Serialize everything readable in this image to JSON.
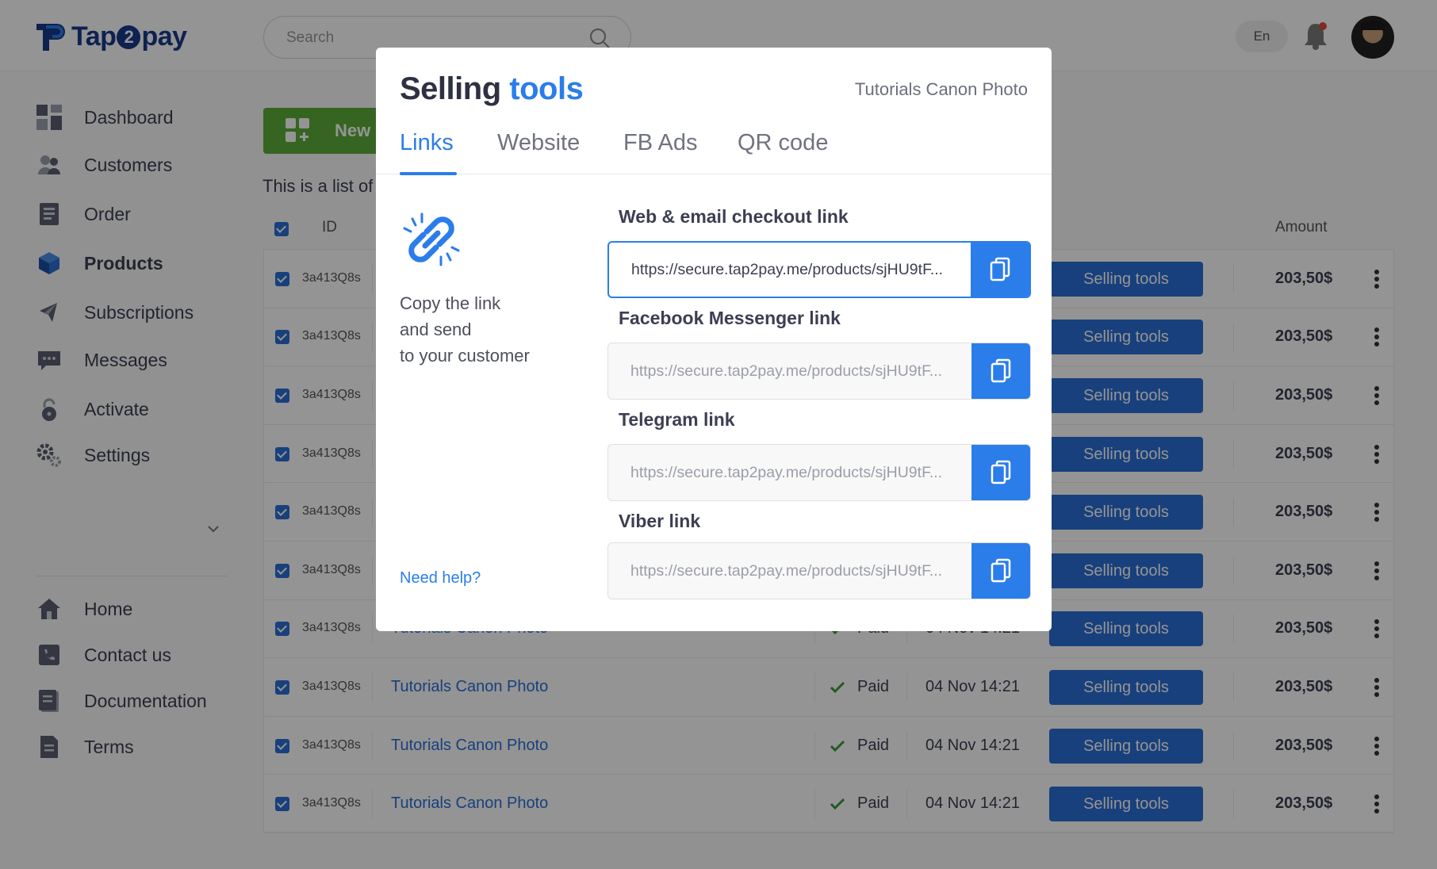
{
  "app": {
    "logo_text_before": "Tap",
    "logo_text_digit": "2",
    "logo_text_after": "pay",
    "brand_color": "#1b3a8c",
    "accent_color": "#2b7de9"
  },
  "header": {
    "search_placeholder": "Search",
    "language": "En"
  },
  "sidebar": {
    "items": [
      {
        "label": "Dashboard",
        "icon": "dashboard-icon"
      },
      {
        "label": "Customers",
        "icon": "customers-icon"
      },
      {
        "label": "Order",
        "icon": "order-icon"
      },
      {
        "label": "Products",
        "icon": "products-icon",
        "active": true
      },
      {
        "label": "Subscriptions",
        "icon": "subscriptions-icon"
      },
      {
        "label": "Messages",
        "icon": "messages-icon"
      },
      {
        "label": "Activate",
        "icon": "lock-icon"
      },
      {
        "label": "Settings",
        "icon": "gear-icon"
      }
    ],
    "footer_items": [
      {
        "label": "Home",
        "icon": "home-icon"
      },
      {
        "label": "Contact us",
        "icon": "phone-icon"
      },
      {
        "label": "Documentation",
        "icon": "documentation-icon"
      },
      {
        "label": "Terms",
        "icon": "document-icon"
      }
    ]
  },
  "main": {
    "new_button_label": "New p",
    "list_caption": "This is a list of",
    "columns": {
      "id": "ID",
      "amount": "Amount"
    },
    "rows": [
      {
        "id": "3a413Q8s",
        "name": "",
        "status": "",
        "date": "",
        "action": "Selling tools",
        "amount": "203,50$"
      },
      {
        "id": "3a413Q8s",
        "name": "",
        "status": "",
        "date": "",
        "action": "Selling tools",
        "amount": "203,50$"
      },
      {
        "id": "3a413Q8s",
        "name": "",
        "status": "",
        "date": "",
        "action": "Selling tools",
        "amount": "203,50$"
      },
      {
        "id": "3a413Q8s",
        "name": "",
        "status": "",
        "date": "",
        "action": "Selling tools",
        "amount": "203,50$"
      },
      {
        "id": "3a413Q8s",
        "name": "",
        "status": "",
        "date": "",
        "action": "Selling tools",
        "amount": "203,50$"
      },
      {
        "id": "3a413Q8s",
        "name": "",
        "status": "",
        "date": "",
        "action": "Selling tools",
        "amount": "203,50$"
      },
      {
        "id": "3a413Q8s",
        "name": "Tutorials Canon Photo",
        "status": "Paid",
        "date": "04 Nov 14:21",
        "action": "Selling tools",
        "amount": "203,50$"
      },
      {
        "id": "3a413Q8s",
        "name": "Tutorials Canon Photo",
        "status": "Paid",
        "date": "04 Nov 14:21",
        "action": "Selling tools",
        "amount": "203,50$"
      },
      {
        "id": "3a413Q8s",
        "name": "Tutorials Canon Photo",
        "status": "Paid",
        "date": "04 Nov 14:21",
        "action": "Selling tools",
        "amount": "203,50$"
      },
      {
        "id": "3a413Q8s",
        "name": "Tutorials Canon Photo",
        "status": "Paid",
        "date": "04 Nov 14:21",
        "action": "Selling tools",
        "amount": "203,50$"
      }
    ]
  },
  "modal": {
    "title_part1": "Selling",
    "title_part2": "tools",
    "product_name": "Tutorials Canon Photo",
    "tabs": [
      {
        "label": "Links",
        "active": true
      },
      {
        "label": "Website"
      },
      {
        "label": "FB Ads"
      },
      {
        "label": "QR code"
      }
    ],
    "hint_lines": [
      "Copy the link",
      "and send",
      "to your customer"
    ],
    "help_link": "Need help?",
    "links": [
      {
        "label": "Web & email checkout link",
        "value": "https://secure.tap2pay.me/products/sjHU9tF...",
        "focused": true
      },
      {
        "label": "Facebook Messenger link",
        "value": "https://secure.tap2pay.me/products/sjHU9tF..."
      },
      {
        "label": "Telegram link",
        "value": "https://secure.tap2pay.me/products/sjHU9tF..."
      },
      {
        "label": "Viber link",
        "value": "https://secure.tap2pay.me/products/sjHU9tF..."
      }
    ]
  }
}
